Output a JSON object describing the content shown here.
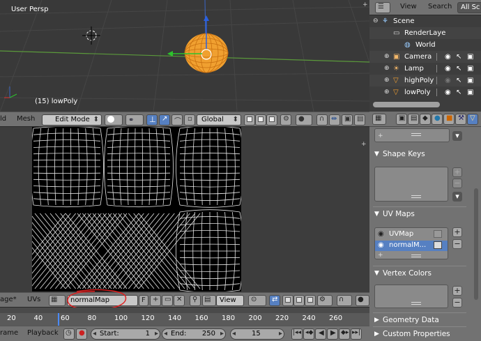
{
  "viewport": {
    "label": "User Persp",
    "object_info": "(15) lowPoly"
  },
  "header3d": {
    "menu_partial": "ld",
    "mesh_menu": "Mesh",
    "mode": "Edit Mode",
    "orientation": "Global"
  },
  "uv_header": {
    "image_menu_partial": "age*",
    "uvs_menu": "UVs",
    "image_name": "normalMap",
    "fake_user": "F",
    "view_menu": "View"
  },
  "timeline": {
    "ticks": [
      "20",
      "40",
      "60",
      "80",
      "100",
      "120",
      "140",
      "160",
      "180",
      "200",
      "220",
      "240",
      "260"
    ],
    "frame_menu_partial": "rame",
    "playback_menu": "Playback",
    "start_label": "Start:",
    "start_value": "1",
    "end_label": "End:",
    "end_value": "250",
    "current_frame": "15"
  },
  "outliner": {
    "view_menu": "View",
    "search_menu": "Search",
    "filter_partial": "All Sc",
    "items": [
      {
        "label": "Scene"
      },
      {
        "label": "RenderLaye"
      },
      {
        "label": "World"
      },
      {
        "label": "Camera"
      },
      {
        "label": "Lamp"
      },
      {
        "label": "highPoly"
      },
      {
        "label": "lowPoly"
      }
    ]
  },
  "properties": {
    "shape_keys_title": "Shape Keys",
    "uv_maps_title": "UV Maps",
    "uv_maps": [
      {
        "label": "UVMap"
      },
      {
        "label": "normalM..."
      }
    ],
    "vertex_colors_title": "Vertex Colors",
    "geometry_data_title": "Geometry Data",
    "custom_properties_title": "Custom Properties"
  },
  "colors": {
    "active_blue": "#5680c2",
    "selection_orange": "#f0a030",
    "annotation_red": "#e02020"
  }
}
